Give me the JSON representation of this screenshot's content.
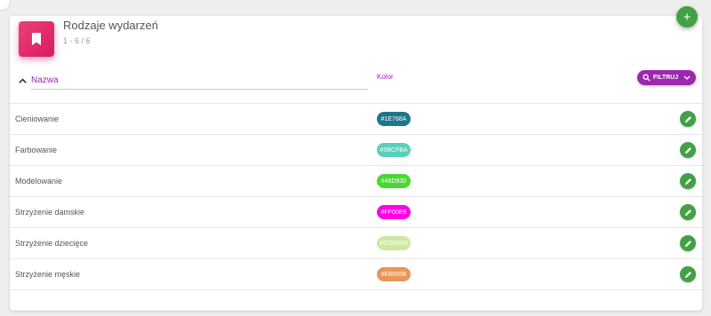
{
  "header": {
    "title": "Rodzaje wydarzeń",
    "count": "1 - 6 / 6",
    "icon": "bookmark-icon",
    "add_label": "+"
  },
  "filters": {
    "name_label": "Nazwa",
    "color_label": "Kolor",
    "filter_button_label": "FILTRUJ"
  },
  "colors": {
    "accent": "#9c27b0",
    "header_icon": "#e91e63",
    "action_green": "#43a047"
  },
  "rows": [
    {
      "name": "Cieniowanie",
      "color": "#1E768A"
    },
    {
      "name": "Farbowanie",
      "color": "#5BCFBA"
    },
    {
      "name": "Modelowanie",
      "color": "#48D930"
    },
    {
      "name": "Strzyżenie damskie",
      "color": "#FF00E6"
    },
    {
      "name": "Strzyżenie dziecięce",
      "color": "#CDE8A0"
    },
    {
      "name": "Strzyżenie męskie",
      "color": "#E8965B"
    }
  ]
}
